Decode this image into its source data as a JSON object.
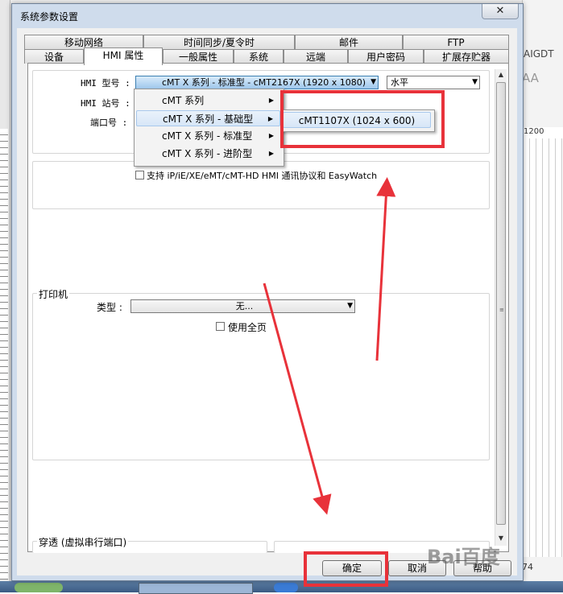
{
  "dialog": {
    "title": "系统参数设置",
    "close_glyph": "✕"
  },
  "tabs_row1": [
    {
      "label": "移动网络"
    },
    {
      "label": "时间同步/夏令时"
    },
    {
      "label": "邮件"
    },
    {
      "label": "FTP"
    }
  ],
  "tabs_row2": [
    {
      "label": "设备"
    },
    {
      "label": "HMI 属性",
      "active": true
    },
    {
      "label": "一般属性"
    },
    {
      "label": "系统"
    },
    {
      "label": "远端"
    },
    {
      "label": "用户密码"
    },
    {
      "label": "扩展存贮器"
    }
  ],
  "hmi": {
    "model_label": "HMI 型号 :",
    "model_value": "cMT X 系列 - 标准型 - cMT2167X (1920 x 1080)",
    "orientation_value": "水平",
    "station_label": "HMI 站号 :",
    "port_label": "端口号 :",
    "support_label": "支持 iP/iE/XE/eMT/cMT-HD HMI 通讯协议和 EasyWatch"
  },
  "model_menu": {
    "items": [
      {
        "label": "cMT 系列"
      },
      {
        "label": "cMT X 系列 - 基础型",
        "hover": true
      },
      {
        "label": "cMT X 系列 - 标准型"
      },
      {
        "label": "cMT X 系列 - 进阶型"
      }
    ],
    "submenu_item": "cMT1107X (1024 x 600)"
  },
  "printer": {
    "group_label": "打印机",
    "type_label": "类型 :",
    "type_value": "无...",
    "full_page_label": "使用全页"
  },
  "passthrough": {
    "group_label": "穿透 (虚拟串行端口)"
  },
  "buttons": {
    "ok": "确定",
    "cancel": "取消",
    "help": "帮助"
  },
  "background": {
    "right_tab": "AIGDT",
    "right_tools": "AA",
    "ruler_value": "1200",
    "bottom_value": "74"
  },
  "watermark": "Bai百度",
  "colors": {
    "annotation": "#e8323a",
    "dialog_frame": "#cfdcec",
    "menu_hover": "#d7e6f7"
  },
  "icons": {
    "submenu": "triangle-right",
    "dropdown": "triangle-down",
    "close": "x"
  }
}
